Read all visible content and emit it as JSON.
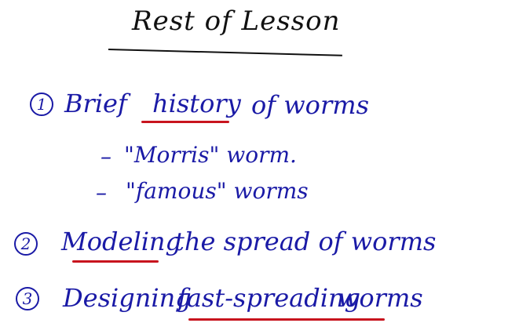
{
  "title": "Rest of Lesson",
  "items": [
    {
      "number": "1",
      "pre": "Brief",
      "highlight": "history",
      "post": "of worms"
    },
    {
      "number": "2",
      "highlight": "Modeling",
      "post": "the spread of worms"
    },
    {
      "number": "3",
      "pre": "Designing",
      "highlight": "fast-spreading",
      "post": "worms"
    }
  ],
  "subitems": [
    {
      "dash": "–",
      "text": "\"Morris\" worm."
    },
    {
      "dash": "–",
      "text": "\"famous\" worms"
    }
  ],
  "colors": {
    "ink_black": "#111111",
    "ink_blue": "#1a1aa6",
    "ink_red": "#c8141e"
  }
}
